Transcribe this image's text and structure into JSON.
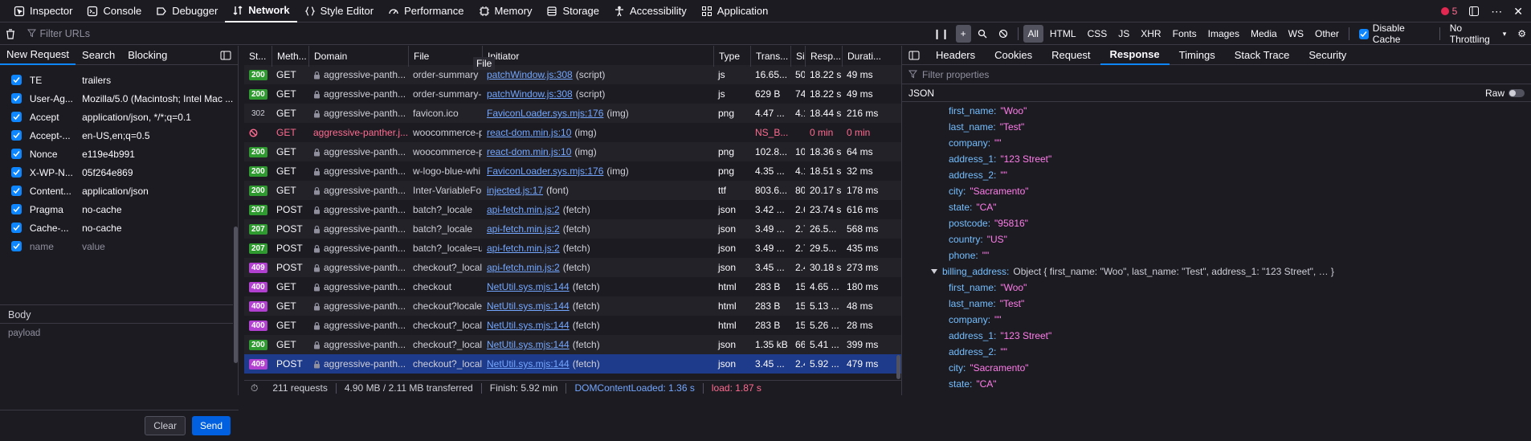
{
  "toolbox": {
    "tabs": [
      {
        "label": "Inspector",
        "icon": "inspector-icon"
      },
      {
        "label": "Console",
        "icon": "console-icon"
      },
      {
        "label": "Debugger",
        "icon": "debugger-icon"
      },
      {
        "label": "Network",
        "icon": "network-icon",
        "active": true
      },
      {
        "label": "Style Editor",
        "icon": "style-editor-icon"
      },
      {
        "label": "Performance",
        "icon": "performance-icon"
      },
      {
        "label": "Memory",
        "icon": "memory-icon"
      },
      {
        "label": "Storage",
        "icon": "storage-icon"
      },
      {
        "label": "Accessibility",
        "icon": "accessibility-icon"
      },
      {
        "label": "Application",
        "icon": "application-icon"
      }
    ],
    "error_count": "5"
  },
  "filterbar": {
    "placeholder": "Filter URLs",
    "types": [
      "All",
      "HTML",
      "CSS",
      "JS",
      "XHR",
      "Fonts",
      "Images",
      "Media",
      "WS",
      "Other"
    ],
    "active_type": "All",
    "disable_cache_label": "Disable Cache",
    "throttling_label": "No Throttling"
  },
  "left_pane": {
    "tabs": [
      "New Request",
      "Search",
      "Blocking"
    ],
    "active_tab": "New Request",
    "headers": [
      {
        "name": "TE",
        "value": "trailers"
      },
      {
        "name": "User-Ag...",
        "value": "Mozilla/5.0 (Macintosh; Intel Mac ..."
      },
      {
        "name": "Accept",
        "value": "application/json, */*;q=0.1"
      },
      {
        "name": "Accept-...",
        "value": "en-US,en;q=0.5"
      },
      {
        "name": "Nonce",
        "value": "e119e4b991"
      },
      {
        "name": "X-WP-N...",
        "value": "05f264e869"
      },
      {
        "name": "Content...",
        "value": "application/json"
      },
      {
        "name": "Pragma",
        "value": "no-cache"
      },
      {
        "name": "Cache-...",
        "value": "no-cache"
      }
    ],
    "header_placeholder": {
      "name": "name",
      "value": "value"
    },
    "body_label": "Body",
    "payload_placeholder": "payload",
    "clear_label": "Clear",
    "send_label": "Send"
  },
  "table": {
    "columns": [
      "St...",
      "Meth...",
      "Domain",
      "File",
      "Initiator",
      "Type",
      "Trans...",
      "Si",
      "Resp...",
      "Durati..."
    ],
    "rows": [
      {
        "status": "200",
        "method": "GET",
        "domain": "aggressive-panth...",
        "file": "order-summary",
        "initiator_link": "patchWindow.js:308",
        "initiator_rest": "(script)",
        "type": "js",
        "transferred": "16.65...",
        "size": "50",
        "response": "18.22 s",
        "duration": "49 ms"
      },
      {
        "status": "200",
        "method": "GET",
        "domain": "aggressive-panth...",
        "file": "order-summary-",
        "initiator_link": "patchWindow.js:308",
        "initiator_rest": "(script)",
        "type": "js",
        "transferred": "629 B",
        "size": "74",
        "response": "18.22 s",
        "duration": "49 ms"
      },
      {
        "status": "302",
        "method": "GET",
        "domain": "aggressive-panth...",
        "file": "favicon.ico",
        "initiator_link": "FaviconLoader.sys.mjs:176",
        "initiator_rest": "(img)",
        "type": "png",
        "transferred": "4.47 ...",
        "size": "4.1",
        "response": "18.44 s",
        "duration": "216 ms"
      },
      {
        "status": "blocked",
        "method": "GET",
        "domain": "aggressive-panther.j...",
        "file": "woocommerce-p",
        "initiator_link": "react-dom.min.js:10",
        "initiator_rest": "(img)",
        "type": "",
        "transferred": "NS_B...",
        "size": "",
        "response": "0 min",
        "duration": "0 min"
      },
      {
        "status": "200",
        "method": "GET",
        "domain": "aggressive-panth...",
        "file": "woocommerce-p",
        "initiator_link": "react-dom.min.js:10",
        "initiator_rest": "(img)",
        "type": "png",
        "transferred": "102.8...",
        "size": "10",
        "response": "18.36 s",
        "duration": "64 ms"
      },
      {
        "status": "200",
        "method": "GET",
        "domain": "aggressive-panth...",
        "file": "w-logo-blue-whi",
        "initiator_link": "FaviconLoader.sys.mjs:176",
        "initiator_rest": "(img)",
        "type": "png",
        "transferred": "4.35 ...",
        "size": "4.1",
        "response": "18.51 s",
        "duration": "32 ms"
      },
      {
        "status": "200",
        "method": "GET",
        "domain": "aggressive-panth...",
        "file": "Inter-VariableFor",
        "initiator_link": "injected.js:17",
        "initiator_rest": "(font)",
        "type": "ttf",
        "transferred": "803.6...",
        "size": "80",
        "response": "20.17 s",
        "duration": "178 ms"
      },
      {
        "status": "207",
        "method": "POST",
        "domain": "aggressive-panth...",
        "file": "batch?_locale",
        "initiator_link": "api-fetch.min.js:2",
        "initiator_rest": "(fetch)",
        "type": "json",
        "transferred": "3.42 ...",
        "size": "2.6",
        "response": "23.74 s",
        "duration": "616 ms"
      },
      {
        "status": "207",
        "method": "POST",
        "domain": "aggressive-panth...",
        "file": "batch?_locale",
        "initiator_link": "api-fetch.min.js:2",
        "initiator_rest": "(fetch)",
        "type": "json",
        "transferred": "3.49 ...",
        "size": "2.7",
        "response": "26.5...",
        "duration": "568 ms"
      },
      {
        "status": "207",
        "method": "POST",
        "domain": "aggressive-panth...",
        "file": "batch?_locale=u",
        "initiator_link": "api-fetch.min.js:2",
        "initiator_rest": "(fetch)",
        "type": "json",
        "transferred": "3.49 ...",
        "size": "2.7",
        "response": "29.5...",
        "duration": "435 ms"
      },
      {
        "status": "409",
        "method": "POST",
        "domain": "aggressive-panth...",
        "file": "checkout?_locale",
        "initiator_link": "api-fetch.min.js:2",
        "initiator_rest": "(fetch)",
        "type": "json",
        "transferred": "3.45 ...",
        "size": "2.4",
        "response": "30.18 s",
        "duration": "273 ms"
      },
      {
        "status": "400",
        "method": "GET",
        "domain": "aggressive-panth...",
        "file": "checkout",
        "initiator_link": "NetUtil.sys.mjs:144",
        "initiator_rest": "(fetch)",
        "type": "html",
        "transferred": "283 B",
        "size": "15",
        "response": "4.65 ...",
        "duration": "180 ms"
      },
      {
        "status": "400",
        "method": "GET",
        "domain": "aggressive-panth...",
        "file": "checkout?locale=",
        "initiator_link": "NetUtil.sys.mjs:144",
        "initiator_rest": "(fetch)",
        "type": "html",
        "transferred": "283 B",
        "size": "15",
        "response": "5.13 ...",
        "duration": "48 ms"
      },
      {
        "status": "400",
        "method": "GET",
        "domain": "aggressive-panth...",
        "file": "checkout?_locale",
        "initiator_link": "NetUtil.sys.mjs:144",
        "initiator_rest": "(fetch)",
        "type": "html",
        "transferred": "283 B",
        "size": "15",
        "response": "5.26 ...",
        "duration": "28 ms"
      },
      {
        "status": "200",
        "method": "GET",
        "domain": "aggressive-panth...",
        "file": "checkout?_locale",
        "initiator_link": "NetUtil.sys.mjs:144",
        "initiator_rest": "(fetch)",
        "type": "json",
        "transferred": "1.35 kB",
        "size": "66",
        "response": "5.41 ...",
        "duration": "399 ms"
      },
      {
        "status": "409",
        "method": "POST",
        "domain": "aggressive-panth...",
        "file": "checkout?_locale",
        "initiator_link": "NetUtil.sys.mjs:144",
        "initiator_rest": "(fetch)",
        "type": "json",
        "transferred": "3.45 ...",
        "size": "2.4",
        "response": "5.92 ...",
        "duration": "479 ms",
        "selected": true
      }
    ],
    "tooltip": "File"
  },
  "statusbar": {
    "requests": "211 requests",
    "transferred": "4.90 MB / 2.11 MB transferred",
    "finish": "Finish: 5.92 min",
    "dom_loaded": "DOMContentLoaded: 1.36 s",
    "load": "load: 1.87 s"
  },
  "details": {
    "tabs": [
      "Headers",
      "Cookies",
      "Request",
      "Response",
      "Timings",
      "Stack Trace",
      "Security"
    ],
    "active_tab": "Response",
    "filter_placeholder": "Filter properties",
    "json_label": "JSON",
    "raw_label": "Raw",
    "rows": [
      {
        "key": "first_name:",
        "value": "\"Woo\"",
        "indent": 1
      },
      {
        "key": "last_name:",
        "value": "\"Test\"",
        "indent": 1
      },
      {
        "key": "company:",
        "value": "\"\"",
        "indent": 1
      },
      {
        "key": "address_1:",
        "value": "\"123 Street\"",
        "indent": 1
      },
      {
        "key": "address_2:",
        "value": "\"\"",
        "indent": 1
      },
      {
        "key": "city:",
        "value": "\"Sacramento\"",
        "indent": 1
      },
      {
        "key": "state:",
        "value": "\"CA\"",
        "indent": 1
      },
      {
        "key": "postcode:",
        "value": "\"95816\"",
        "indent": 1
      },
      {
        "key": "country:",
        "value": "\"US\"",
        "indent": 1
      },
      {
        "key": "phone:",
        "value": "\"\"",
        "indent": 1
      },
      {
        "key": "billing_address:",
        "object": "Object { first_name: \"Woo\", last_name: \"Test\", address_1: \"123 Street\", … }",
        "indent": 0,
        "expanded": true
      },
      {
        "key": "first_name:",
        "value": "\"Woo\"",
        "indent": 1
      },
      {
        "key": "last_name:",
        "value": "\"Test\"",
        "indent": 1
      },
      {
        "key": "company:",
        "value": "\"\"",
        "indent": 1
      },
      {
        "key": "address_1:",
        "value": "\"123 Street\"",
        "indent": 1
      },
      {
        "key": "address_2:",
        "value": "\"\"",
        "indent": 1
      },
      {
        "key": "city:",
        "value": "\"Sacramento\"",
        "indent": 1
      },
      {
        "key": "state:",
        "value": "\"CA\"",
        "indent": 1
      }
    ]
  }
}
